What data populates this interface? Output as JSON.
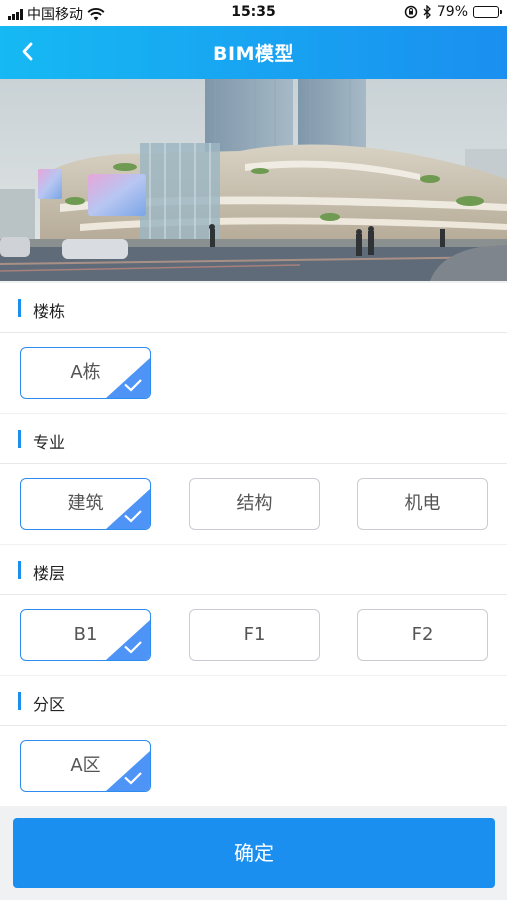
{
  "status_bar": {
    "carrier": "中国移动",
    "time": "15:35",
    "battery_text": "79%",
    "battery_level": 0.79
  },
  "nav": {
    "title": "BIM模型"
  },
  "sections": {
    "building": {
      "label": "楼栋",
      "options": [
        "A栋"
      ],
      "selected": "A栋"
    },
    "discipline": {
      "label": "专业",
      "options": [
        "建筑",
        "结构",
        "机电"
      ],
      "selected": "建筑"
    },
    "floor": {
      "label": "楼层",
      "options": [
        "B1",
        "F1",
        "F2"
      ],
      "selected": "B1"
    },
    "zone": {
      "label": "分区",
      "options": [
        "A区"
      ],
      "selected": "A区"
    }
  },
  "confirm_label": "确定",
  "colors": {
    "nav_gradient_start": "#16b9f3",
    "nav_gradient_end": "#1a8ff0",
    "accent": "#1a8ff0",
    "selected_corner": "#4d94f6"
  }
}
